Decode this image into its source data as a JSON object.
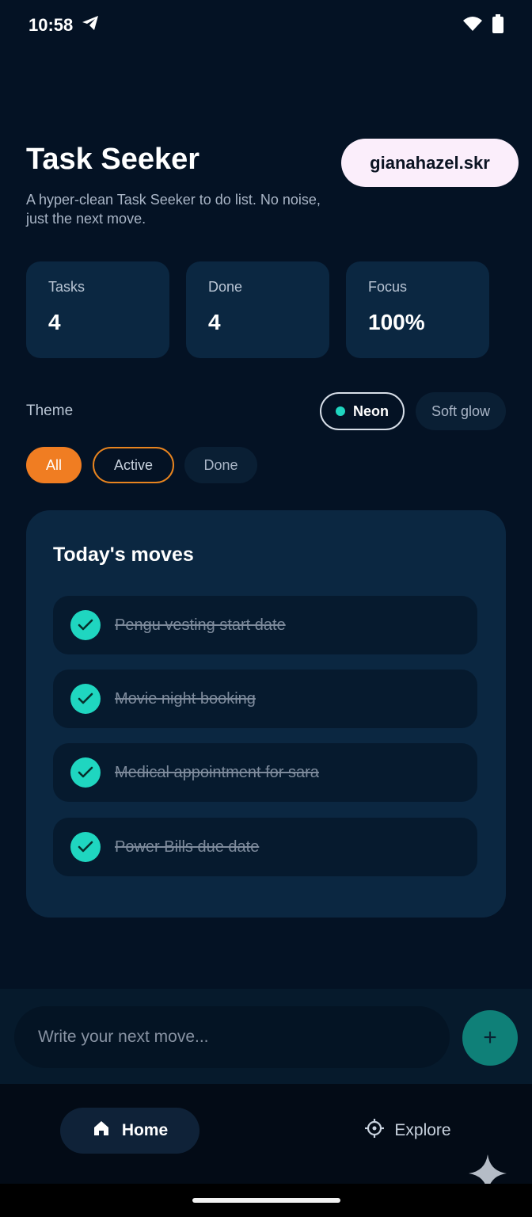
{
  "status_bar": {
    "time": "10:58"
  },
  "header": {
    "title": "Task Seeker",
    "subtitle": "A hyper-clean Task Seeker to do list. No noise, just the next move.",
    "wallet": "gianahazel.skr"
  },
  "stats": [
    {
      "label": "Tasks",
      "value": "4"
    },
    {
      "label": "Done",
      "value": "4"
    },
    {
      "label": "Focus",
      "value": "100%"
    }
  ],
  "theme": {
    "label": "Theme",
    "options": [
      "Neon",
      "Soft glow"
    ],
    "selected": "Neon"
  },
  "filters": {
    "items": [
      "All",
      "Active",
      "Done"
    ],
    "selected": "All"
  },
  "moves": {
    "title": "Today's moves",
    "tasks": [
      {
        "text": "Pengu vesting start date",
        "done": true
      },
      {
        "text": "Movie night booking",
        "done": true
      },
      {
        "text": "Medical appointment for sara",
        "done": true
      },
      {
        "text": "Power Bills due date",
        "done": true
      }
    ]
  },
  "composer": {
    "placeholder": "Write your next move...",
    "add_label": "+"
  },
  "nav": {
    "home": "Home",
    "explore": "Explore"
  },
  "colors": {
    "background": "#041224",
    "card": "#0b2741",
    "accent_teal": "#1fd6c0",
    "accent_orange": "#f07d22"
  }
}
